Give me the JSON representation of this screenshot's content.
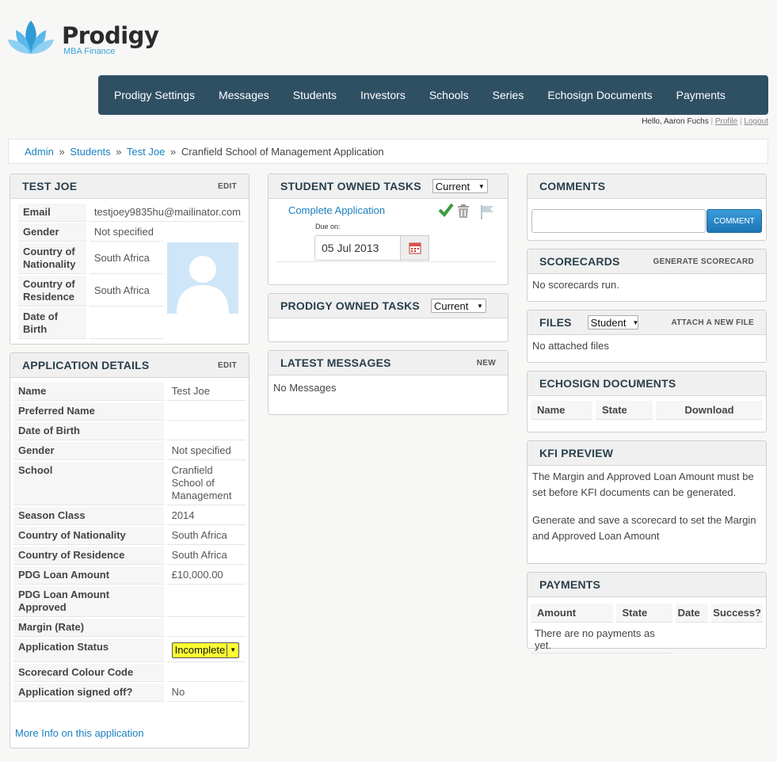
{
  "logo": {
    "name": "Prodigy",
    "sub": "MBA Finance"
  },
  "nav": [
    "Prodigy Settings",
    "Messages",
    "Students",
    "Investors",
    "Schools",
    "Series",
    "Echosign Documents",
    "Payments"
  ],
  "user": {
    "greeting": "Hello, Aaron Fuchs",
    "profile": "Profile",
    "logout": "Logout",
    "sep": "|"
  },
  "breadcrumb": {
    "items": [
      "Admin",
      "Students",
      "Test Joe"
    ],
    "current": "Cranfield School of Management Application",
    "sep": "»"
  },
  "student": {
    "title": "TEST JOE",
    "edit": "EDIT",
    "email_label": "Email",
    "email": "testjoey9835hu@mailinator.com",
    "gender_label": "Gender",
    "gender": "Not specified",
    "nationality_label": "Country of Nationality",
    "nationality": "South Africa",
    "residence_label": "Country of Residence",
    "residence": "South Africa",
    "dob_label": "Date of Birth",
    "dob": ""
  },
  "application": {
    "title": "APPLICATION DETAILS",
    "edit": "EDIT",
    "rows": [
      {
        "label": "Name",
        "value": "Test Joe"
      },
      {
        "label": "Preferred Name",
        "value": ""
      },
      {
        "label": "Date of Birth",
        "value": ""
      },
      {
        "label": "Gender",
        "value": "Not specified"
      },
      {
        "label": "School",
        "value": "Cranfield School of Management"
      },
      {
        "label": "Season Class",
        "value": "2014"
      },
      {
        "label": "Country of Nationality",
        "value": "South Africa"
      },
      {
        "label": "Country of Residence",
        "value": "South Africa"
      },
      {
        "label": "PDG Loan Amount",
        "value": "£10,000.00"
      },
      {
        "label": "PDG Loan Amount Approved",
        "value": ""
      },
      {
        "label": "Margin (Rate)",
        "value": ""
      },
      {
        "label": "Application Status",
        "value": "Incomplete"
      },
      {
        "label": "Scorecard Colour Code",
        "value": ""
      },
      {
        "label": "Application signed off?",
        "value": "No"
      }
    ],
    "more_info": "More Info on this application"
  },
  "student_tasks": {
    "title": "STUDENT OWNED TASKS",
    "filter": "Current",
    "task": "Complete Application",
    "due_label": "Due on:",
    "due_date": "05 Jul 2013"
  },
  "prodigy_tasks": {
    "title": "PRODIGY OWNED TASKS",
    "filter": "Current"
  },
  "messages": {
    "title": "LATEST MESSAGES",
    "new": "NEW",
    "empty": "No Messages"
  },
  "comments": {
    "title": "COMMENTS",
    "button": "COMMENT",
    "placeholder": ""
  },
  "scorecards": {
    "title": "SCORECARDS",
    "action": "GENERATE SCORECARD",
    "empty": "No scorecards run."
  },
  "files": {
    "title": "FILES",
    "filter": "Student",
    "action": "ATTACH A NEW FILE",
    "empty": "No attached files"
  },
  "echosign": {
    "title": "ECHOSIGN DOCUMENTS",
    "columns": [
      "Name",
      "State",
      "Download"
    ]
  },
  "kfi": {
    "title": "KFI PREVIEW",
    "p1": "The Margin and Approved Loan Amount must be set before KFI documents can be generated.",
    "p2": "Generate and save a scorecard to set the Margin and Approved Loan Amount"
  },
  "payments": {
    "title": "PAYMENTS",
    "columns": [
      "Amount",
      "State",
      "Date",
      "Success?"
    ],
    "empty": "There are no payments as yet."
  },
  "colors": {
    "nav_bg": "#2f5063",
    "link": "#1a7fc1",
    "status_highlight": "#ffff33",
    "button": "#1e75b5",
    "check": "#3a9b3a"
  }
}
